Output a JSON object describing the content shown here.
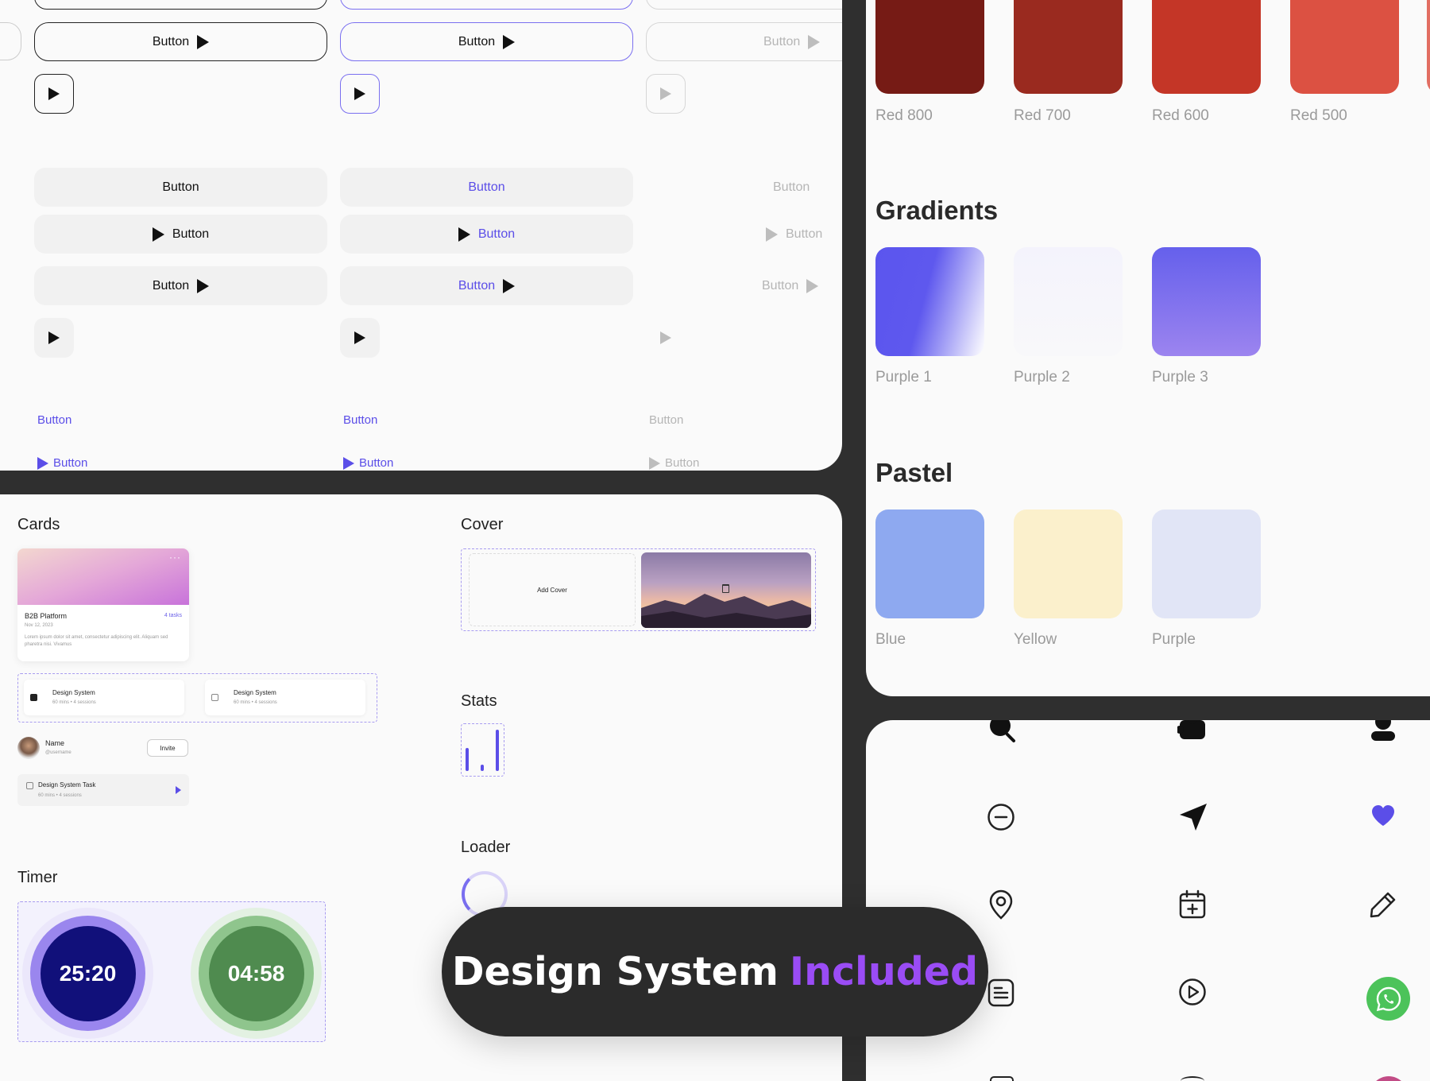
{
  "buttons": {
    "label": "Button"
  },
  "colors": {
    "red": [
      {
        "label": "Red 800",
        "hex": "#761b15"
      },
      {
        "label": "Red 700",
        "hex": "#9a2a1f"
      },
      {
        "label": "Red 600",
        "hex": "#c43627"
      },
      {
        "label": "Red 500",
        "hex": "#dc5142"
      }
    ],
    "gradients_title": "Gradients",
    "gradients": [
      {
        "label": "Purple 1"
      },
      {
        "label": "Purple 2"
      },
      {
        "label": "Purple 3"
      }
    ],
    "pastel_title": "Pastel",
    "pastel": [
      {
        "label": "Blue",
        "hex": "#8ea9f0"
      },
      {
        "label": "Yellow",
        "hex": "#fbf0cc"
      },
      {
        "label": "Purple",
        "hex": "#e1e5f6"
      }
    ]
  },
  "components": {
    "cards_title": "Cards",
    "card": {
      "title": "B2B Platform",
      "tasks": "4 tasks",
      "date": "Nov 12, 2023",
      "body": "Lorem ipsum dolor sit amet, consectetur adipiscing elit. Aliquam sed pharetra nisi. Vivamus"
    },
    "sessions": [
      {
        "title": "Design System",
        "meta": "60 mins • 4 sessions",
        "checked": true
      },
      {
        "title": "Design System",
        "meta": "60 mins • 4 sessions",
        "checked": false
      }
    ],
    "user": {
      "name": "Name",
      "handle": "@username",
      "invite": "Invite"
    },
    "task": {
      "title": "Design System Task",
      "meta": "60 mins • 4 sessions"
    },
    "timer_title": "Timer",
    "timers": [
      "25:20",
      "04:58"
    ],
    "cover_title": "Cover",
    "add_cover": "Add Cover",
    "stats_title": "Stats",
    "stats_bars": [
      0.55,
      0.15,
      1.0
    ],
    "loader_title": "Loader"
  },
  "banner": {
    "text": "Design System",
    "highlight": "Included"
  },
  "icons": [
    "search-icon",
    "puzzle-icon",
    "user-icon",
    "minus-circle-icon",
    "send-icon",
    "heart-icon",
    "location-pin-icon",
    "calendar-plus-icon",
    "pencil-icon",
    "document-icon",
    "play-circle-icon",
    "whatsapp-icon"
  ]
}
